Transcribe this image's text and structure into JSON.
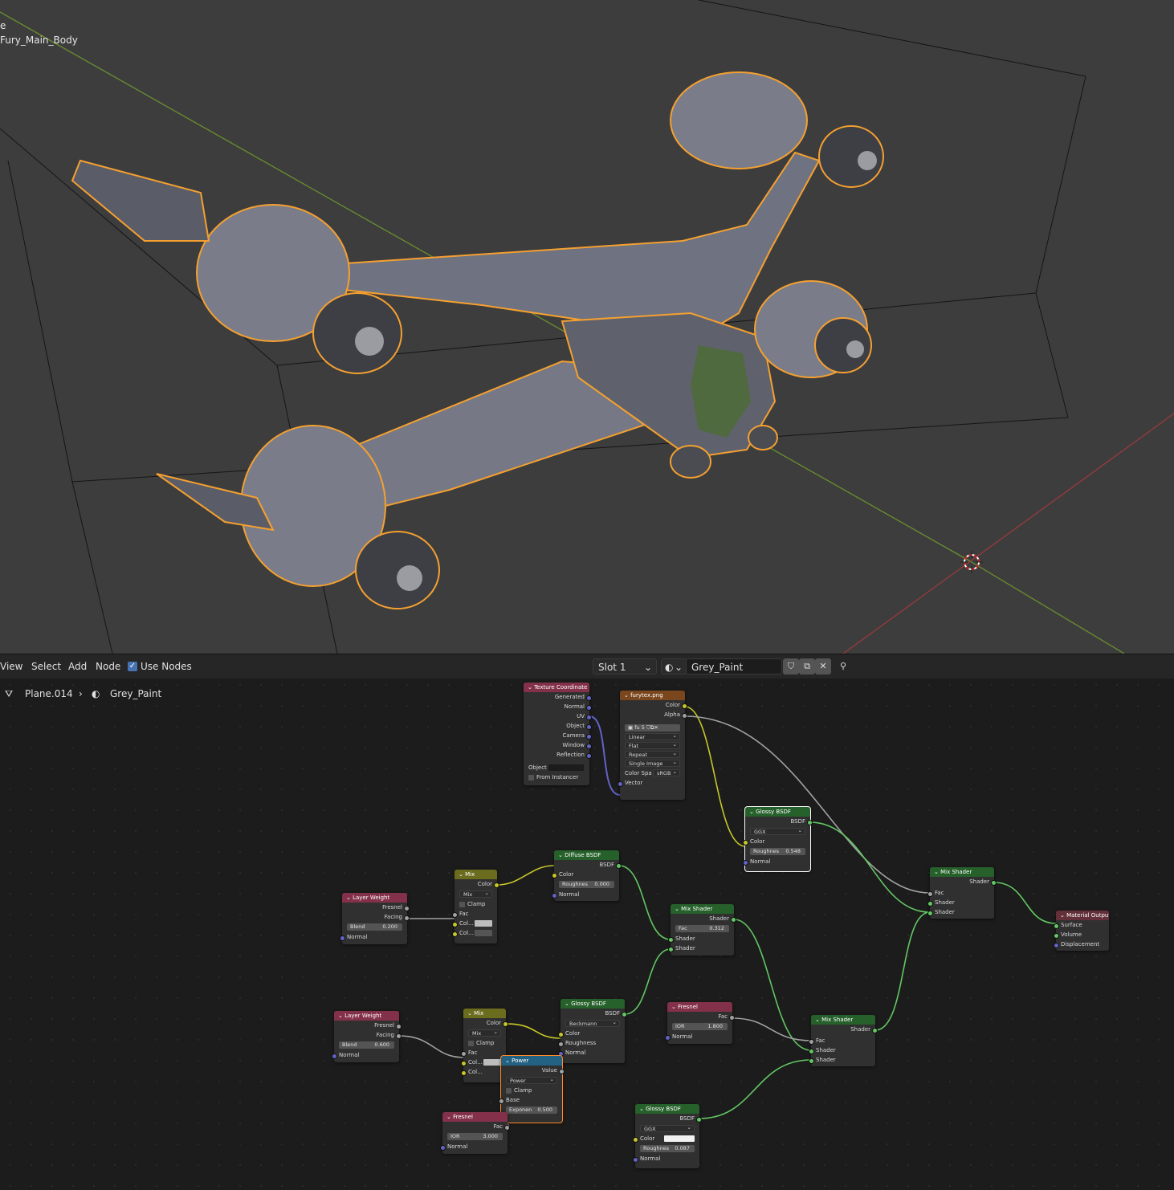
{
  "viewport": {
    "info_line1": "e",
    "info_line2": "Fury_Main_Body"
  },
  "header": {
    "menu": [
      "View",
      "Select",
      "Add",
      "Node"
    ],
    "use_nodes_label": "Use Nodes",
    "slot": "Slot 1",
    "material_name": "Grey_Paint"
  },
  "breadcrumb": {
    "object": "Plane.014",
    "material": "Grey_Paint"
  },
  "nodes": {
    "texcoord": {
      "title": "Texture Coordinate",
      "outputs": [
        "Generated",
        "Normal",
        "UV",
        "Object",
        "Camera",
        "Window",
        "Reflection"
      ],
      "object_label": "Object",
      "from_instancer": "From Instancer"
    },
    "image": {
      "title": "furytex.png",
      "out_color": "Color",
      "out_alpha": "Alpha",
      "file": "fu",
      "users": "5",
      "interp": "Linear",
      "proj": "Flat",
      "ext": "Repeat",
      "source": "Single Image",
      "colorspace_label": "Color Spa",
      "colorspace": "sRGB",
      "in_vector": "Vector"
    },
    "glossy1": {
      "title": "Glossy BSDF",
      "out": "BSDF",
      "dist": "GGX",
      "color": "Color",
      "rough_label": "Roughnes",
      "rough": "0.548",
      "normal": "Normal"
    },
    "diffuse": {
      "title": "Diffuse BSDF",
      "out": "BSDF",
      "color": "Color",
      "rough_label": "Roughnes",
      "rough": "0.000",
      "normal": "Normal"
    },
    "mix1": {
      "title": "Mix",
      "out": "Color",
      "blend": "Mix",
      "clamp": "Clamp",
      "fac": "Fac",
      "col1": "Col...",
      "col2": "Col..."
    },
    "layerweight1": {
      "title": "Layer Weight",
      "fresnel": "Fresnel",
      "facing": "Facing",
      "blend_label": "Blend",
      "blend": "0.200",
      "normal": "Normal"
    },
    "mixshader1": {
      "title": "Mix Shader",
      "out": "Shader",
      "fac_label": "Fac",
      "fac": "0.312",
      "shader1": "Shader",
      "shader2": "Shader"
    },
    "mixshader_main": {
      "title": "Mix Shader",
      "out": "Shader",
      "fac": "Fac",
      "shader1": "Shader",
      "shader2": "Shader"
    },
    "output": {
      "title": "Material Output",
      "surface": "Surface",
      "volume": "Volume",
      "displacement": "Displacement"
    },
    "layerweight2": {
      "title": "Layer Weight",
      "fresnel": "Fresnel",
      "facing": "Facing",
      "blend_label": "Blend",
      "blend": "0.600",
      "normal": "Normal"
    },
    "mix2": {
      "title": "Mix",
      "out": "Color",
      "blend": "Mix",
      "clamp": "Clamp",
      "fac": "Fac",
      "col1": "Col...",
      "col2": "Col..."
    },
    "glossy2": {
      "title": "Glossy BSDF",
      "out": "BSDF",
      "dist": "Beckmann",
      "color": "Color",
      "rough": "Roughness",
      "normal": "Normal"
    },
    "power": {
      "title": "Power",
      "out": "Value",
      "op": "Power",
      "clamp": "Clamp",
      "base": "Base",
      "exp_label": "Exponen",
      "exp": "0.500"
    },
    "fresnel1": {
      "title": "Fresnel",
      "out": "Fac",
      "ior_label": "IOR",
      "ior": "1.800",
      "normal": "Normal"
    },
    "mixshader2": {
      "title": "Mix Shader",
      "out": "Shader",
      "fac": "Fac",
      "shader1": "Shader",
      "shader2": "Shader"
    },
    "fresnel2": {
      "title": "Fresnel",
      "out": "Fac",
      "ior_label": "IOR",
      "ior": "3.000",
      "normal": "Normal"
    },
    "glossy3": {
      "title": "Glossy BSDF",
      "out": "BSDF",
      "dist": "GGX",
      "color": "Color",
      "rough_label": "Roughnes",
      "rough": "0.087",
      "normal": "Normal"
    }
  },
  "colors": {
    "selection_outline": "#f5a030",
    "shader_link": "#63c763",
    "color_link": "#c7c729",
    "value_link": "#a1a1a1",
    "vector_link": "#6363c7"
  }
}
